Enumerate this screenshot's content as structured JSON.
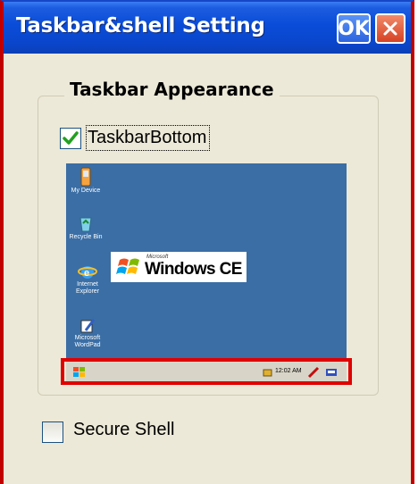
{
  "window": {
    "title": "Taskbar&shell Setting",
    "ok_label": "OK",
    "close_icon": "close-icon",
    "accent": "#0a46cc"
  },
  "group": {
    "title": "Taskbar Appearance"
  },
  "taskbar_bottom": {
    "label": "TaskbarBottom",
    "checked": true
  },
  "preview": {
    "icons": [
      {
        "name": "My Device"
      },
      {
        "name": "Recycle Bin"
      },
      {
        "name": "Internet Explorer"
      },
      {
        "name": "Microsoft WordPad"
      }
    ],
    "logo_small": "Microsoft",
    "logo_text": "Windows CE",
    "clock": "12:02 AM",
    "desktop_color": "#3a6ea5"
  },
  "secure_shell": {
    "label": "Secure Shell",
    "checked": false
  },
  "highlight_color": "#e00000"
}
